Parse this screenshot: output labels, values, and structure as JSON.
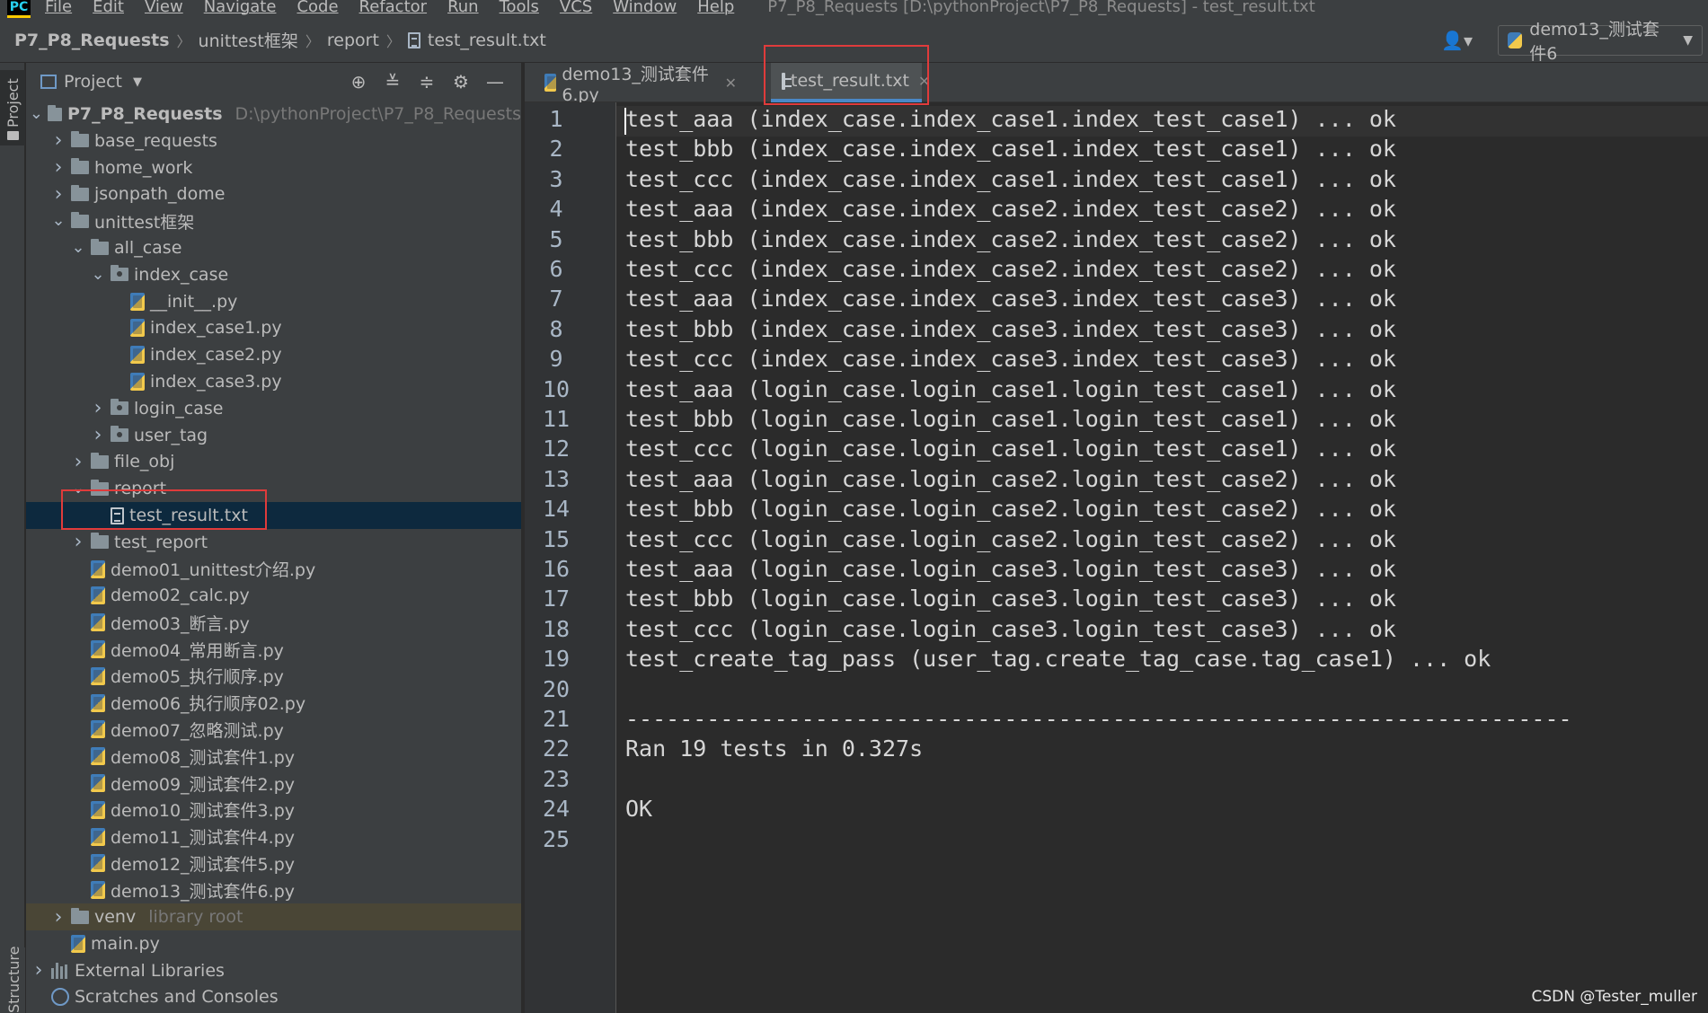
{
  "menubar": {
    "logo": "PC",
    "items": [
      "File",
      "Edit",
      "View",
      "Navigate",
      "Code",
      "Refactor",
      "Run",
      "Tools",
      "VCS",
      "Window",
      "Help"
    ],
    "window_title": "P7_P8_Requests [D:\\pythonProject\\P7_P8_Requests] - test_result.txt"
  },
  "navbar": {
    "breadcrumbs": [
      "P7_P8_Requests",
      "unittest框架",
      "report",
      "test_result.txt"
    ],
    "user_icon": "person-dropdown-icon",
    "run_config": "demo13_测试套件6"
  },
  "stripe": {
    "project_label": "Project",
    "structure_label": "Structure"
  },
  "project_panel": {
    "title": "Project",
    "tool_icons": [
      "locate-icon",
      "expand-all-icon",
      "collapse-all-icon",
      "gear-icon",
      "minimize-icon"
    ],
    "tree": [
      {
        "label": "P7_P8_Requests",
        "hint": "D:\\pythonProject\\P7_P8_Requests",
        "type": "folder",
        "expanded": true,
        "depth": 0,
        "bold": true
      },
      {
        "label": "base_requests",
        "type": "folder",
        "expanded": false,
        "depth": 1
      },
      {
        "label": "home_work",
        "type": "folder",
        "expanded": false,
        "depth": 1
      },
      {
        "label": "jsonpath_dome",
        "type": "folder",
        "expanded": false,
        "depth": 1
      },
      {
        "label": "unittest框架",
        "type": "folder",
        "expanded": true,
        "depth": 1
      },
      {
        "label": "all_case",
        "type": "folder",
        "expanded": true,
        "depth": 2
      },
      {
        "label": "index_case",
        "type": "package",
        "expanded": true,
        "depth": 3
      },
      {
        "label": "__init__.py",
        "type": "py",
        "depth": 4
      },
      {
        "label": "index_case1.py",
        "type": "py",
        "depth": 4
      },
      {
        "label": "index_case2.py",
        "type": "py",
        "depth": 4
      },
      {
        "label": "index_case3.py",
        "type": "py",
        "depth": 4
      },
      {
        "label": "login_case",
        "type": "package",
        "expanded": false,
        "depth": 3
      },
      {
        "label": "user_tag",
        "type": "package",
        "expanded": false,
        "depth": 3
      },
      {
        "label": "file_obj",
        "type": "folder",
        "expanded": false,
        "depth": 2
      },
      {
        "label": "report",
        "type": "folder",
        "expanded": true,
        "depth": 2
      },
      {
        "label": "test_result.txt",
        "type": "txt",
        "depth": 3,
        "selected": true
      },
      {
        "label": "test_report",
        "type": "folder",
        "expanded": false,
        "depth": 2
      },
      {
        "label": "demo01_unittest介绍.py",
        "type": "py",
        "depth": 2
      },
      {
        "label": "demo02_calc.py",
        "type": "py",
        "depth": 2
      },
      {
        "label": "demo03_断言.py",
        "type": "py",
        "depth": 2
      },
      {
        "label": "demo04_常用断言.py",
        "type": "py",
        "depth": 2
      },
      {
        "label": "demo05_执行顺序.py",
        "type": "py",
        "depth": 2
      },
      {
        "label": "demo06_执行顺序02.py",
        "type": "py",
        "depth": 2
      },
      {
        "label": "demo07_忽略测试.py",
        "type": "py",
        "depth": 2
      },
      {
        "label": "demo08_测试套件1.py",
        "type": "py",
        "depth": 2
      },
      {
        "label": "demo09_测试套件2.py",
        "type": "py",
        "depth": 2
      },
      {
        "label": "demo10_测试套件3.py",
        "type": "py",
        "depth": 2
      },
      {
        "label": "demo11_测试套件4.py",
        "type": "py",
        "depth": 2
      },
      {
        "label": "demo12_测试套件5.py",
        "type": "py",
        "depth": 2
      },
      {
        "label": "demo13_测试套件6.py",
        "type": "py",
        "depth": 2
      },
      {
        "label": "venv",
        "hint": "library root",
        "type": "folder",
        "expanded": false,
        "depth": 1,
        "venv": true
      },
      {
        "label": "main.py",
        "type": "py",
        "depth": 1
      },
      {
        "label": "External Libraries",
        "type": "libs",
        "expanded": false,
        "depth": 0
      },
      {
        "label": "Scratches and Consoles",
        "type": "scratch",
        "depth": 0
      }
    ]
  },
  "editor": {
    "tabs": [
      {
        "label": "demo13_测试套件6.py",
        "type": "py",
        "active": false
      },
      {
        "label": "test_result.txt",
        "type": "txt",
        "active": true
      }
    ],
    "lines": [
      "test_aaa (index_case.index_case1.index_test_case1) ... ok",
      "test_bbb (index_case.index_case1.index_test_case1) ... ok",
      "test_ccc (index_case.index_case1.index_test_case1) ... ok",
      "test_aaa (index_case.index_case2.index_test_case2) ... ok",
      "test_bbb (index_case.index_case2.index_test_case2) ... ok",
      "test_ccc (index_case.index_case2.index_test_case2) ... ok",
      "test_aaa (index_case.index_case3.index_test_case3) ... ok",
      "test_bbb (index_case.index_case3.index_test_case3) ... ok",
      "test_ccc (index_case.index_case3.index_test_case3) ... ok",
      "test_aaa (login_case.login_case1.login_test_case1) ... ok",
      "test_bbb (login_case.login_case1.login_test_case1) ... ok",
      "test_ccc (login_case.login_case1.login_test_case1) ... ok",
      "test_aaa (login_case.login_case2.login_test_case2) ... ok",
      "test_bbb (login_case.login_case2.login_test_case2) ... ok",
      "test_ccc (login_case.login_case2.login_test_case2) ... ok",
      "test_aaa (login_case.login_case3.login_test_case3) ... ok",
      "test_bbb (login_case.login_case3.login_test_case3) ... ok",
      "test_ccc (login_case.login_case3.login_test_case3) ... ok",
      "test_create_tag_pass (user_tag.create_tag_case.tag_case1) ... ok",
      "",
      "----------------------------------------------------------------------",
      "Ran 19 tests in 0.327s",
      "",
      "OK",
      ""
    ]
  },
  "watermark": "CSDN @Tester_muller",
  "colors": {
    "annotation_box": "#e03b3b",
    "selection": "#0d293e",
    "active_tab_underline": "#4a88c7"
  }
}
